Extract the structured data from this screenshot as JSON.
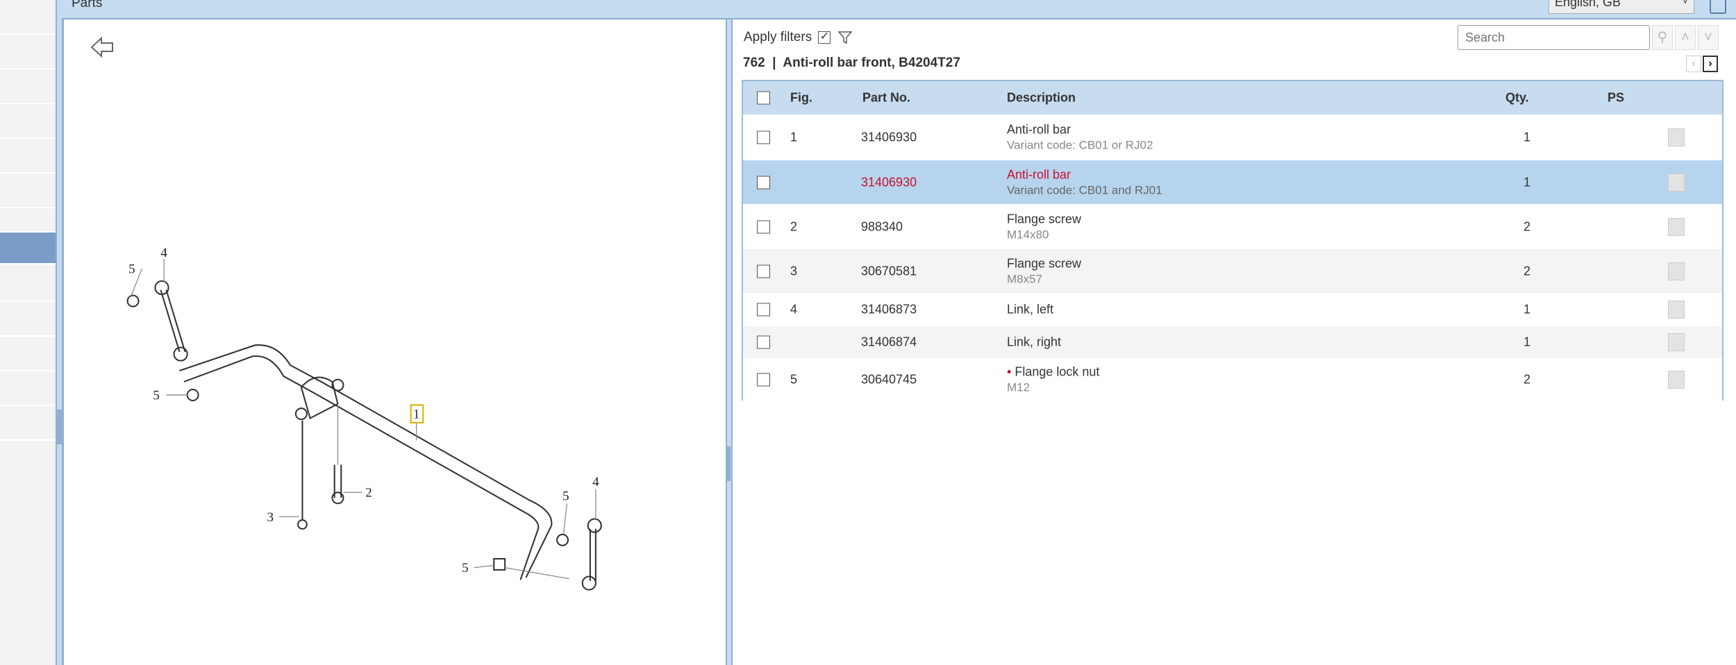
{
  "header": {
    "title": "Parts",
    "language": "English, GB"
  },
  "filters": {
    "label": "Apply filters",
    "checked": true
  },
  "search": {
    "placeholder": "Search"
  },
  "group": {
    "title": "762  |  Anti-roll bar front, B4204T27"
  },
  "table": {
    "headers": {
      "fig": "Fig.",
      "part": "Part No.",
      "desc": "Description",
      "qty": "Qty.",
      "ps": "PS"
    },
    "rows": [
      {
        "fig": "1",
        "part": "31406930",
        "desc": "Anti-roll bar",
        "sub": "Variant code: CB01 or RJ02",
        "qty": "1"
      },
      {
        "fig": "",
        "part": "31406930",
        "desc": "Anti-roll bar",
        "sub": "Variant code: CB01 and RJ01",
        "qty": "1",
        "selected": true
      },
      {
        "fig": "2",
        "part": "988340",
        "desc": "Flange screw",
        "sub": "M14x80",
        "qty": "2"
      },
      {
        "fig": "3",
        "part": "30670581",
        "desc": "Flange screw",
        "sub": "M8x57",
        "qty": "2"
      },
      {
        "fig": "4",
        "part": "31406873",
        "desc": "Link, left",
        "sub": "",
        "qty": "1"
      },
      {
        "fig": "",
        "part": "31406874",
        "desc": "Link, right",
        "sub": "",
        "qty": "1"
      },
      {
        "fig": "5",
        "part": "30640745",
        "desc": "Flange lock nut",
        "sub": "M12",
        "qty": "2",
        "marker": "•"
      }
    ]
  },
  "diagram": {
    "callouts": [
      "4",
      "5",
      "5",
      "1",
      "2",
      "3",
      "5",
      "4",
      "5"
    ]
  },
  "colors": {
    "accent": "#c5dcf1",
    "selected": "#b7d4ee",
    "highlight_text": "#c8102e",
    "nav_active": "#7a9cc6"
  }
}
